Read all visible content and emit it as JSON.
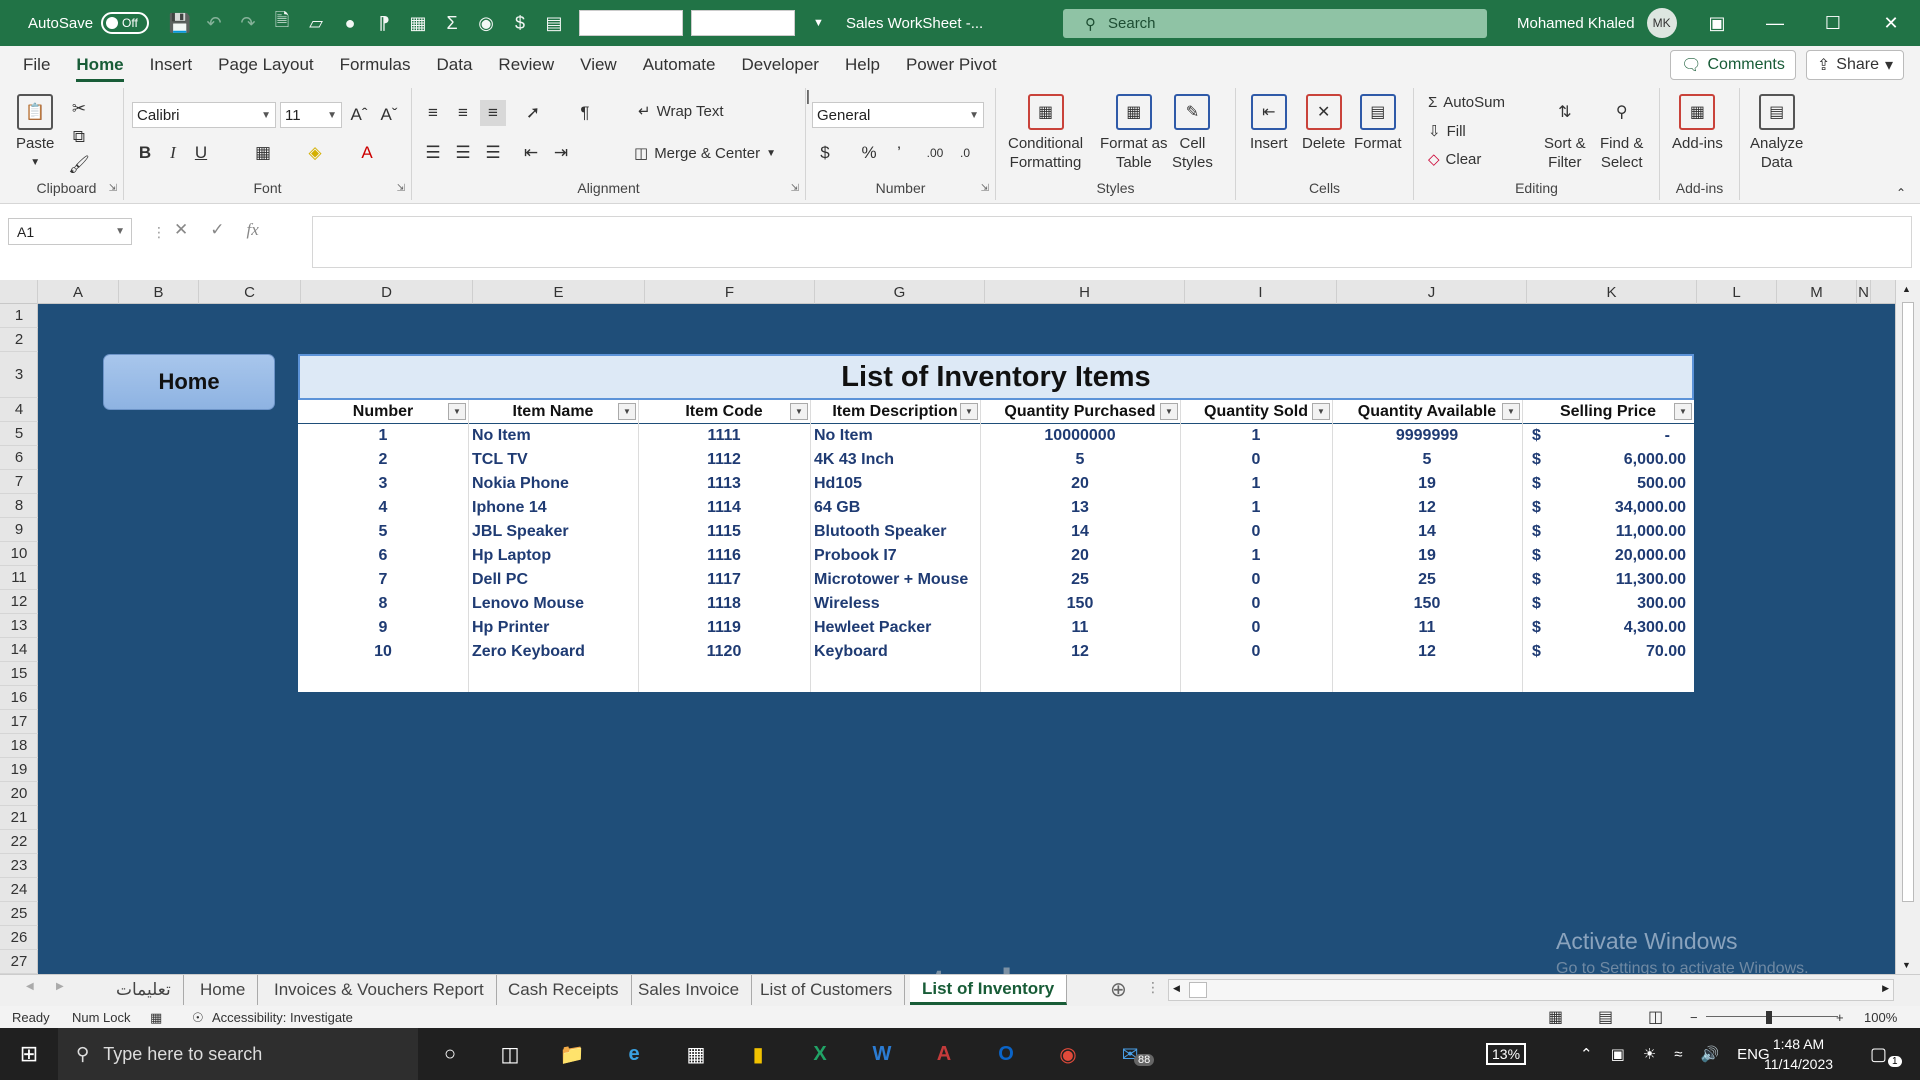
{
  "titlebar": {
    "autosave_label": "AutoSave",
    "autosave_state": "Off",
    "doc_title": "Sales WorkSheet  -...",
    "search_placeholder": "Search",
    "user_name": "Mohamed Khaled",
    "user_initials": "MK"
  },
  "menu": {
    "tabs": [
      "File",
      "Home",
      "Insert",
      "Page Layout",
      "Formulas",
      "Data",
      "Review",
      "View",
      "Automate",
      "Developer",
      "Help",
      "Power Pivot"
    ],
    "active": "Home",
    "comments_label": "Comments",
    "share_label": "Share"
  },
  "ribbon": {
    "clipboard": {
      "paste": "Paste",
      "label": "Clipboard"
    },
    "font": {
      "name": "Calibri",
      "size": "11",
      "label": "Font"
    },
    "alignment": {
      "wrap": "Wrap Text",
      "merge": "Merge & Center",
      "label": "Alignment"
    },
    "number": {
      "format": "General",
      "label": "Number"
    },
    "styles": {
      "cond1": "Conditional",
      "cond2": "Formatting",
      "fmt1": "Format as",
      "fmt2": "Table",
      "cell1": "Cell",
      "cell2": "Styles",
      "label": "Styles"
    },
    "cells": {
      "insert": "Insert",
      "delete": "Delete",
      "format": "Format",
      "label": "Cells"
    },
    "editing": {
      "autosum": "AutoSum",
      "fill": "Fill",
      "clear": "Clear",
      "sort1": "Sort &",
      "sort2": "Filter",
      "find1": "Find &",
      "find2": "Select",
      "label": "Editing"
    },
    "addins": {
      "addins": "Add-ins",
      "label": "Add-ins",
      "analyze1": "Analyze",
      "analyze2": "Data"
    }
  },
  "formula_bar": {
    "name_box": "A1",
    "fx": "fx",
    "value": ""
  },
  "columns": [
    "A",
    "B",
    "C",
    "D",
    "E",
    "F",
    "G",
    "H",
    "I",
    "J",
    "K",
    "L",
    "M",
    "N"
  ],
  "rows": [
    "1",
    "2",
    "3",
    "4",
    "5",
    "6",
    "7",
    "8",
    "9",
    "10",
    "11",
    "12",
    "13",
    "14",
    "15",
    "16",
    "17",
    "18",
    "19",
    "20",
    "21",
    "22",
    "23",
    "24",
    "25",
    "26",
    "27"
  ],
  "home_button": "Home",
  "table": {
    "title": "List of Inventory Items",
    "headers": [
      "Number",
      "Item Name",
      "Item Code",
      "Item Description",
      "Quantity Purchased",
      "Quantity Sold",
      "Quantity Available",
      "Selling Price"
    ],
    "rows": [
      {
        "num": "1",
        "name": "No Item",
        "code": "1111",
        "desc": "No Item",
        "purchased": "10000000",
        "sold": "1",
        "available": "9999999",
        "currency": "$",
        "price": "-"
      },
      {
        "num": "2",
        "name": "TCL TV",
        "code": "1112",
        "desc": "4K 43 Inch",
        "purchased": "5",
        "sold": "0",
        "available": "5",
        "currency": "$",
        "price": "6,000.00"
      },
      {
        "num": "3",
        "name": "Nokia Phone",
        "code": "1113",
        "desc": "Hd105",
        "purchased": "20",
        "sold": "1",
        "available": "19",
        "currency": "$",
        "price": "500.00"
      },
      {
        "num": "4",
        "name": "Iphone 14",
        "code": "1114",
        "desc": "64 GB",
        "purchased": "13",
        "sold": "1",
        "available": "12",
        "currency": "$",
        "price": "34,000.00"
      },
      {
        "num": "5",
        "name": "JBL Speaker",
        "code": "1115",
        "desc": "Blutooth Speaker",
        "purchased": "14",
        "sold": "0",
        "available": "14",
        "currency": "$",
        "price": "11,000.00"
      },
      {
        "num": "6",
        "name": "Hp Laptop",
        "code": "1116",
        "desc": "Probook I7",
        "purchased": "20",
        "sold": "1",
        "available": "19",
        "currency": "$",
        "price": "20,000.00"
      },
      {
        "num": "7",
        "name": "Dell PC",
        "code": "1117",
        "desc": "Microtower + Mouse",
        "purchased": "25",
        "sold": "0",
        "available": "25",
        "currency": "$",
        "price": "11,300.00"
      },
      {
        "num": "8",
        "name": "Lenovo Mouse",
        "code": "1118",
        "desc": "Wireless",
        "purchased": "150",
        "sold": "0",
        "available": "150",
        "currency": "$",
        "price": "300.00"
      },
      {
        "num": "9",
        "name": "Hp Printer",
        "code": "1119",
        "desc": "Hewleet Packer",
        "purchased": "11",
        "sold": "0",
        "available": "11",
        "currency": "$",
        "price": "4,300.00"
      },
      {
        "num": "10",
        "name": "Zero Keyboard",
        "code": "1120",
        "desc": "Keyboard",
        "purchased": "12",
        "sold": "0",
        "available": "12",
        "currency": "$",
        "price": "70.00"
      }
    ]
  },
  "watermark": {
    "line1": "Activate Windows",
    "line2": "Go to Settings to activate Windows.",
    "brand": "mostaql.com"
  },
  "sheet_tabs": [
    "تعليمات",
    "Home",
    "Invoices & Vouchers Report",
    "Cash Receipts",
    "Sales Invoice",
    "List of Customers",
    "List of Inventory"
  ],
  "active_sheet": "List of Inventory",
  "status": {
    "ready": "Ready",
    "numlock": "Num Lock",
    "accessibility": "Accessibility: Investigate",
    "zoom": "100%"
  },
  "taskbar": {
    "search_placeholder": "Type here to search",
    "battery": "13%",
    "lang": "ENG",
    "time": "1:48 AM",
    "date": "11/14/2023",
    "mail_badge": "88",
    "notif_badge": "1"
  },
  "colors": {
    "excel_green": "#217346",
    "sheet_bg": "#1f4e79",
    "title_fill": "#dde9f6",
    "cell_text": "#1f3b73"
  }
}
